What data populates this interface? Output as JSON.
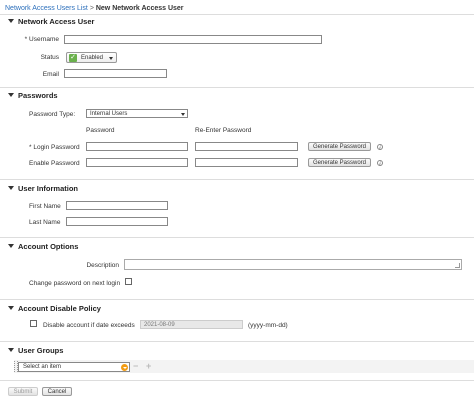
{
  "breadcrumb": {
    "parent": "Network Access Users List",
    "separator": ">",
    "current": "New Network Access User"
  },
  "sections": {
    "network_access_user": "Network Access User",
    "passwords": "Passwords",
    "user_information": "User Information",
    "account_options": "Account Options",
    "account_disable_policy": "Account Disable Policy",
    "user_groups": "User Groups"
  },
  "user": {
    "username_label": "* Username",
    "username_value": "",
    "status_label": "Status",
    "status_value": "Enabled",
    "email_label": "Email",
    "email_value": ""
  },
  "passwords": {
    "type_label": "Password Type:",
    "type_value": "Internal Users",
    "col_password": "Password",
    "col_reenter": "Re-Enter Password",
    "login_label": "* Login Password",
    "enable_label": "Enable Password",
    "generate_label": "Generate Password",
    "info_glyph": "i"
  },
  "user_info": {
    "first_name_label": "First Name",
    "last_name_label": "Last Name"
  },
  "account_options": {
    "description_label": "Description",
    "change_pw_label": "Change password on next login",
    "change_pw_checked": false
  },
  "disable_policy": {
    "label": "Disable account if date exceeds",
    "date_value": "2021-08-09",
    "format_hint": "(yyyy-mm-dd)",
    "checked": false
  },
  "user_groups": {
    "select_value": "Select an item",
    "minus_glyph": "−",
    "plus_glyph": "+"
  },
  "footer": {
    "submit_label": "Submit",
    "cancel_label": "Cancel"
  },
  "colors": {
    "link": "#2a6ebb",
    "status_green": "#6ab04c",
    "dropdown_orange": "#f39c12"
  }
}
